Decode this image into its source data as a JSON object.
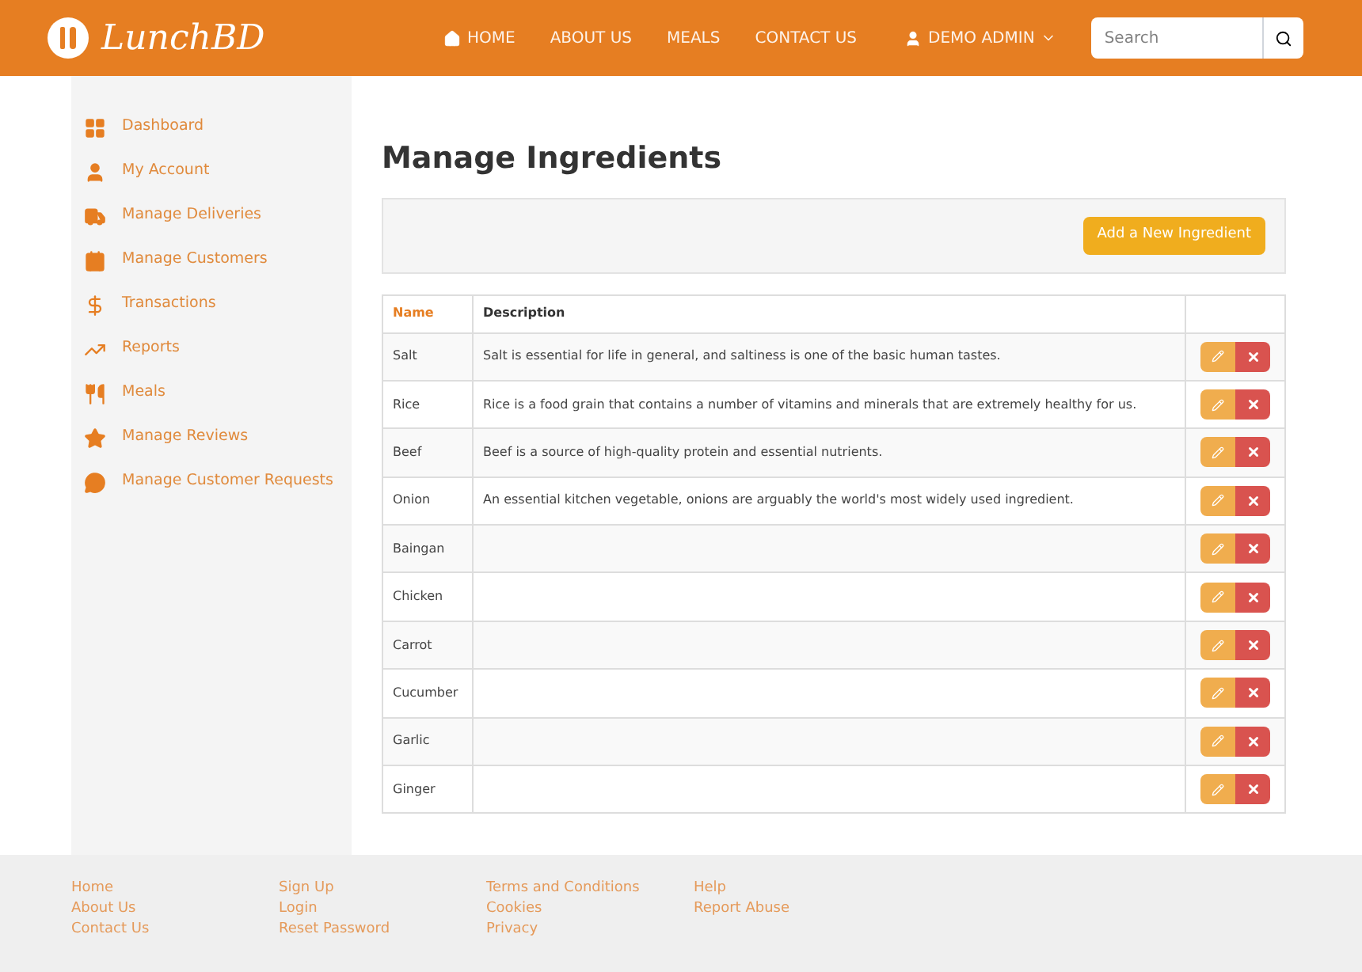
{
  "header": {
    "logo": "LunchBD",
    "nav": [
      {
        "label": "HOME",
        "kind": "home"
      },
      {
        "label": "ABOUT US",
        "kind": "link"
      },
      {
        "label": "MEALS",
        "kind": "link"
      },
      {
        "label": "CONTACT US",
        "kind": "link"
      },
      {
        "label": "DEMO ADMIN",
        "kind": "user"
      }
    ],
    "search": {
      "placeholder": "Search"
    }
  },
  "sidebar": {
    "items": [
      {
        "label": "Dashboard"
      },
      {
        "label": "My Account"
      },
      {
        "label": "Manage Deliveries"
      },
      {
        "label": "Manage Customers"
      },
      {
        "label": "Transactions"
      },
      {
        "label": "Reports"
      },
      {
        "label": "Meals"
      },
      {
        "label": "Manage Reviews"
      },
      {
        "label": "Manage Customer Requests"
      }
    ]
  },
  "page": {
    "title": "Manage Ingredients",
    "add_button": "Add a New Ingredient"
  },
  "table": {
    "columns": [
      {
        "label": "Name",
        "sorted": true
      },
      {
        "label": "Description",
        "sorted": false
      }
    ],
    "rows": [
      {
        "name": "Salt",
        "description": "Salt is essential for life in general, and saltiness is one of the basic human tastes."
      },
      {
        "name": "Rice",
        "description": "Rice is a food grain that contains a number of vitamins and minerals that are extremely healthy for us."
      },
      {
        "name": "Beef",
        "description": "Beef is a source of high-quality protein and essential nutrients."
      },
      {
        "name": "Onion",
        "description": "An essential kitchen vegetable, onions are arguably the world's most widely used ingredient."
      },
      {
        "name": "Baingan"
      },
      {
        "name": "Chicken"
      },
      {
        "name": "Carrot"
      },
      {
        "name": "Cucumber"
      },
      {
        "name": "Garlic"
      },
      {
        "name": "Ginger"
      }
    ]
  },
  "footer": {
    "columns": [
      [
        "Home",
        "About Us",
        "Contact Us"
      ],
      [
        "Sign Up",
        "Login",
        "Reset Password"
      ],
      [
        "Terms and Conditions",
        "Cookies",
        "Privacy"
      ],
      [
        "Help",
        "Report Abuse"
      ]
    ]
  }
}
